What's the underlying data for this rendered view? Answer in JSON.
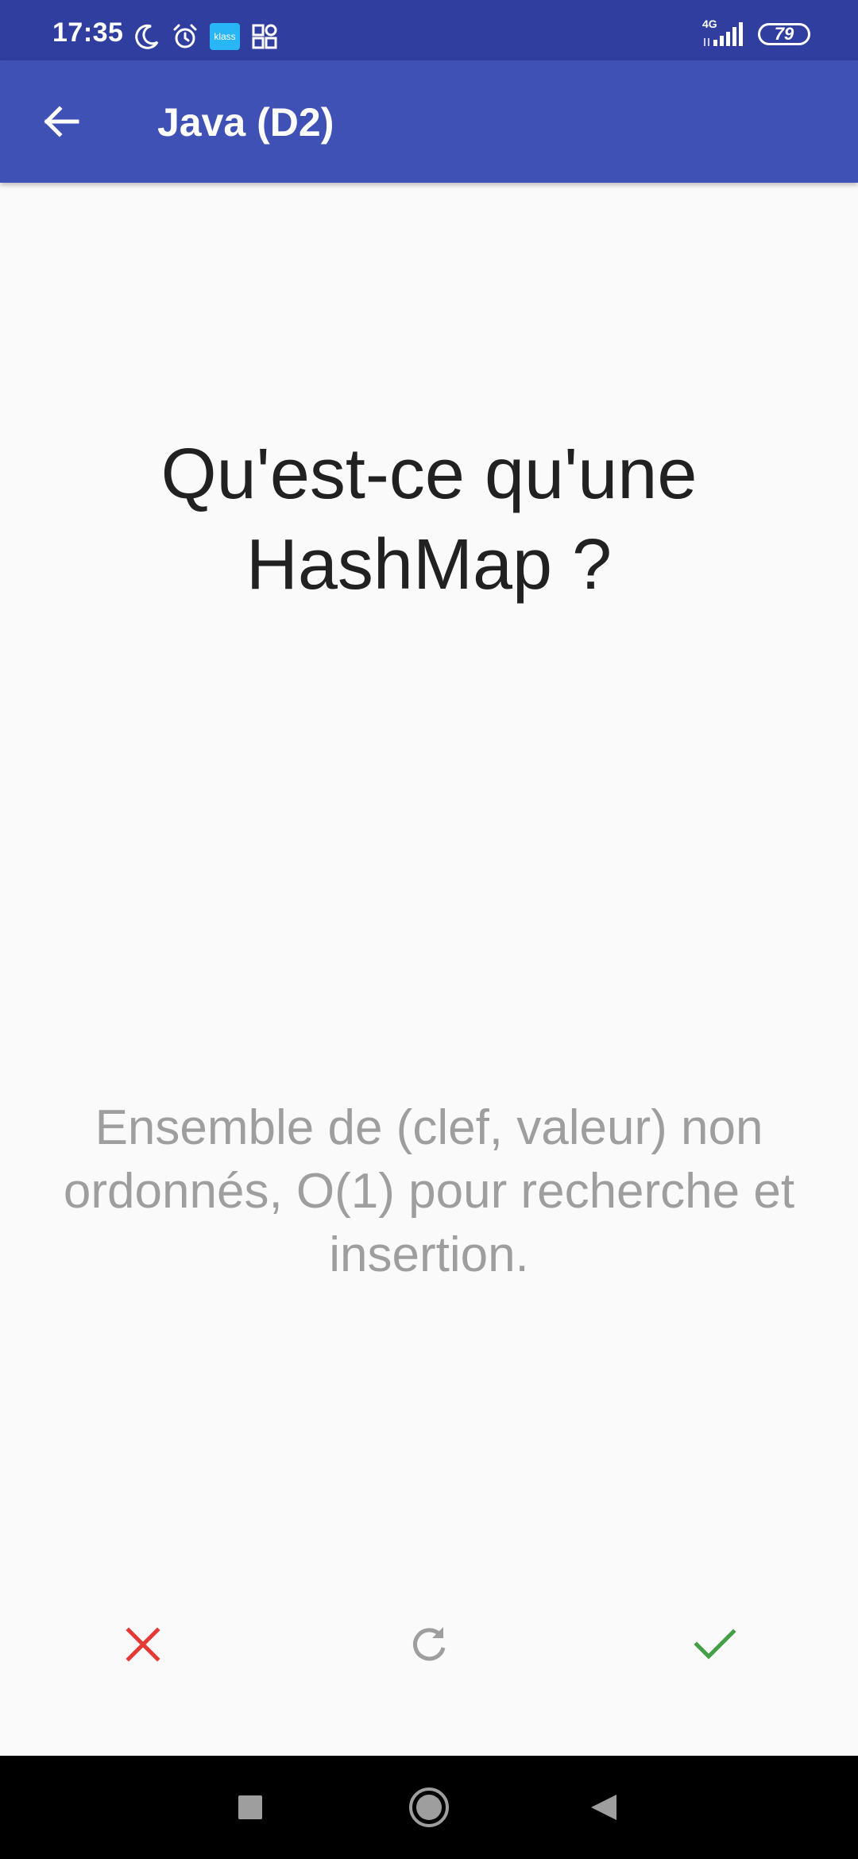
{
  "status_bar": {
    "time": "17:35",
    "klass_label": "klass",
    "network": "4G",
    "battery": "79",
    "icons_left": [
      "moon-icon",
      "alarm-icon",
      "klass-app-icon",
      "grid-app-icon"
    ],
    "icons_right": [
      "signal-icon",
      "battery-icon"
    ]
  },
  "app_bar": {
    "title": "Java (D2)",
    "back_icon": "arrow-back-icon"
  },
  "card": {
    "question": "Qu'est-ce qu'une HashMap ?",
    "answer": "Ensemble de (clef, valeur) non ordonnés, O(1) pour recherche et insertion."
  },
  "actions": {
    "wrong_icon": "close-icon",
    "again_icon": "refresh-icon",
    "right_icon": "check-icon",
    "colors": {
      "wrong": "#e53935",
      "again": "#9e9e9e",
      "right": "#43a047"
    }
  },
  "nav_bar": {
    "icons": [
      "square-recents-icon",
      "circle-home-icon",
      "triangle-back-icon"
    ]
  },
  "colors": {
    "status_bar": "#303f9f",
    "app_bar": "#3f51b5",
    "background": "#fafafa",
    "question_text": "#212121",
    "answer_text": "#9e9e9e"
  }
}
